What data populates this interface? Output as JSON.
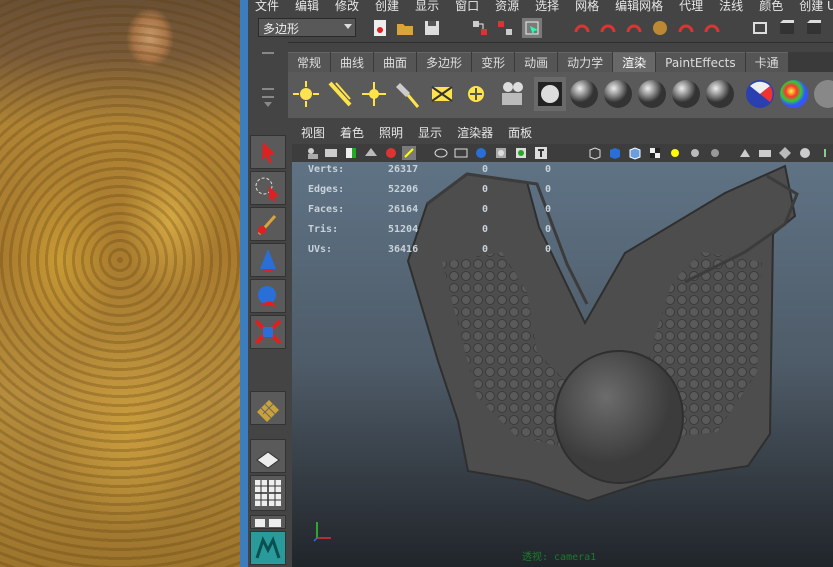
{
  "menubar": {
    "items": [
      "文件",
      "编辑",
      "修改",
      "创建",
      "显示",
      "窗口",
      "资源",
      "选择",
      "网格",
      "编辑网格",
      "代理",
      "法线",
      "颜色",
      "创建 UV"
    ]
  },
  "status_line": {
    "mode_dropdown": "多边形"
  },
  "shelf": {
    "tabs": [
      "常规",
      "曲线",
      "曲面",
      "多边形",
      "变形",
      "动画",
      "动力学",
      "渲染",
      "PaintEffects",
      "卡通"
    ],
    "active_tab": "渲染",
    "icons": [
      "spot-light-icon",
      "area-light-icon",
      "point-light-icon",
      "spotlight-lamp-icon",
      "directional-light-icon",
      "ambient-light-icon",
      "camera-icon",
      "render-icon",
      "sphere-shader-1-icon",
      "sphere-shader-2-icon",
      "sphere-shader-3-icon",
      "sphere-shader-4-icon",
      "sphere-shader-5-icon",
      "beach-ball-shader-icon",
      "rainbow-shader-icon",
      "gray-shader-icon"
    ]
  },
  "panel_menu": {
    "items": [
      "视图",
      "着色",
      "照明",
      "显示",
      "渲染器",
      "面板"
    ]
  },
  "hud": {
    "rows": [
      {
        "label": "Verts:",
        "v1": "26317",
        "v2": "0",
        "v3": "0"
      },
      {
        "label": "Edges:",
        "v1": "52206",
        "v2": "0",
        "v3": "0"
      },
      {
        "label": "Faces:",
        "v1": "26164",
        "v2": "0",
        "v3": "0"
      },
      {
        "label": "Tris:",
        "v1": "51204",
        "v2": "0",
        "v3": "0"
      },
      {
        "label": "UVs:",
        "v1": "36416",
        "v2": "0",
        "v3": "0"
      }
    ],
    "camera": "透视: camera1"
  },
  "colors": {
    "accent_blue": "#3c7dbf",
    "viewport_top": "#5f7385",
    "viewport_bottom": "#20252a",
    "hud_text": "#c8d2da",
    "camera_label": "#1a7a2a"
  }
}
